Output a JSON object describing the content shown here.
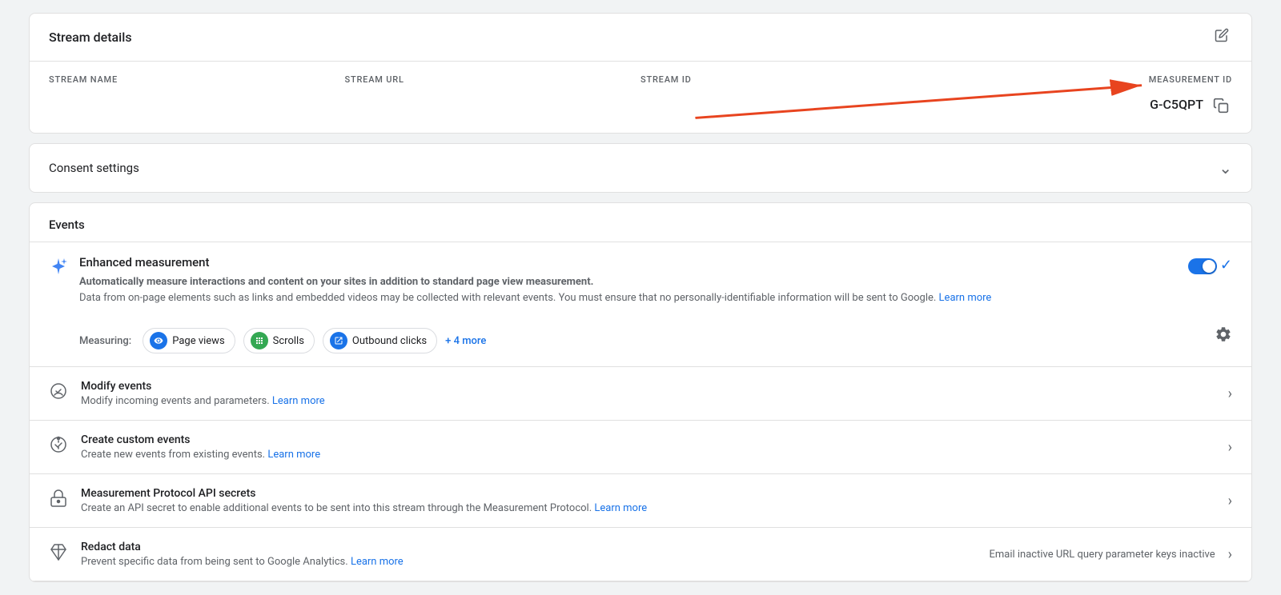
{
  "streamDetails": {
    "title": "Stream details",
    "editIconLabel": "edit",
    "columns": [
      {
        "label": "STREAM NAME",
        "value": ""
      },
      {
        "label": "STREAM URL",
        "value": ""
      },
      {
        "label": "STREAM ID",
        "value": ""
      },
      {
        "label": "MEASUREMENT ID",
        "value": "G-C5QPT"
      }
    ],
    "copyIconLabel": "copy"
  },
  "consentSettings": {
    "title": "Consent settings",
    "chevronLabel": "expand"
  },
  "events": {
    "sectionTitle": "Events",
    "enhancedMeasurement": {
      "title": "Enhanced measurement",
      "iconLabel": "sparkle-icon",
      "description": "Automatically measure interactions and content on your sites in addition to standard page view measurement.",
      "descriptionLine2": "Data from on-page elements such as links and embedded videos may be collected with relevant events. You must ensure that no personally-identifiable information will be sent to Google.",
      "learnMoreLabel": "Learn more",
      "learnMoreUrl": "#",
      "toggleEnabled": true,
      "measuringLabel": "Measuring:",
      "chips": [
        {
          "label": "Page views",
          "iconType": "eye",
          "iconLabel": "page-views-icon"
        },
        {
          "label": "Scrolls",
          "iconType": "scroll",
          "iconLabel": "scrolls-icon"
        },
        {
          "label": "Outbound clicks",
          "iconType": "outbound",
          "iconLabel": "outbound-clicks-icon"
        }
      ],
      "moreLabel": "+ 4 more",
      "settingsIconLabel": "settings-icon"
    },
    "rows": [
      {
        "id": "modify-events",
        "iconLabel": "modify-events-icon",
        "title": "Modify events",
        "description": "Modify incoming events and parameters.",
        "learnMoreLabel": "Learn more",
        "learnMoreUrl": "#",
        "metaRight": ""
      },
      {
        "id": "create-custom-events",
        "iconLabel": "create-custom-events-icon",
        "title": "Create custom events",
        "description": "Create new events from existing events.",
        "learnMoreLabel": "Learn more",
        "learnMoreUrl": "#",
        "metaRight": ""
      },
      {
        "id": "measurement-protocol",
        "iconLabel": "measurement-protocol-icon",
        "title": "Measurement Protocol API secrets",
        "description": "Create an API secret to enable additional events to be sent into this stream through the Measurement Protocol.",
        "learnMoreLabel": "Learn more",
        "learnMoreUrl": "#",
        "metaRight": ""
      },
      {
        "id": "redact-data",
        "iconLabel": "redact-data-icon",
        "title": "Redact data",
        "description": "Prevent specific data from being sent to Google Analytics.",
        "learnMoreLabel": "Learn more",
        "learnMoreUrl": "#",
        "metaRight": "Email inactive     URL query parameter keys inactive"
      }
    ]
  },
  "arrow": {
    "color": "#e8441f"
  }
}
